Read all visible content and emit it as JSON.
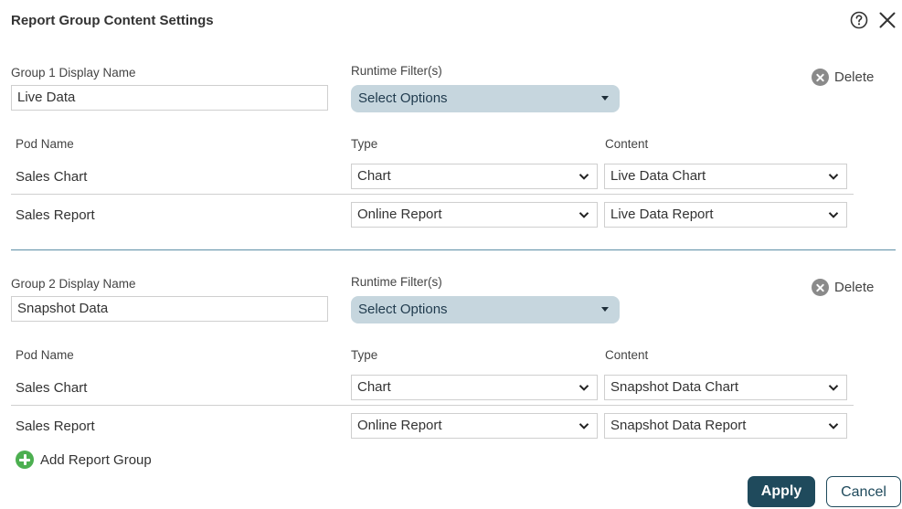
{
  "dialog": {
    "title": "Report Group Content Settings"
  },
  "groups": [
    {
      "display_name_label": "Group 1 Display Name",
      "display_name_value": "Live Data",
      "runtime_filter_label": "Runtime Filter(s)",
      "runtime_filter_value": "Select Options",
      "delete_label": "Delete",
      "pod_name_header": "Pod Name",
      "type_header": "Type",
      "content_header": "Content",
      "rows": [
        {
          "pod_name": "Sales Chart",
          "type": "Chart",
          "content": "Live Data Chart"
        },
        {
          "pod_name": "Sales Report",
          "type": "Online Report",
          "content": "Live Data Report"
        }
      ]
    },
    {
      "display_name_label": "Group 2 Display Name",
      "display_name_value": "Snapshot Data",
      "runtime_filter_label": "Runtime Filter(s)",
      "runtime_filter_value": "Select Options",
      "delete_label": "Delete",
      "pod_name_header": "Pod Name",
      "type_header": "Type",
      "content_header": "Content",
      "rows": [
        {
          "pod_name": "Sales Chart",
          "type": "Chart",
          "content": "Snapshot Data Chart"
        },
        {
          "pod_name": "Sales Report",
          "type": "Online Report",
          "content": "Snapshot Data Report"
        }
      ]
    }
  ],
  "footer": {
    "add_group_label": "Add Report Group",
    "apply_label": "Apply",
    "cancel_label": "Cancel"
  },
  "colors": {
    "primary": "#1f4a5c",
    "filter_bg": "#c6d6de",
    "add_green": "#4caf50",
    "delete_gray": "#8a8a8a",
    "group_separator": "#5d8fa6"
  },
  "icons": {
    "help": "help-circle-icon",
    "close": "close-icon",
    "delete": "delete-circle-icon",
    "add": "plus-circle-icon",
    "chevron": "chevron-down-icon",
    "caret": "caret-down-icon"
  }
}
